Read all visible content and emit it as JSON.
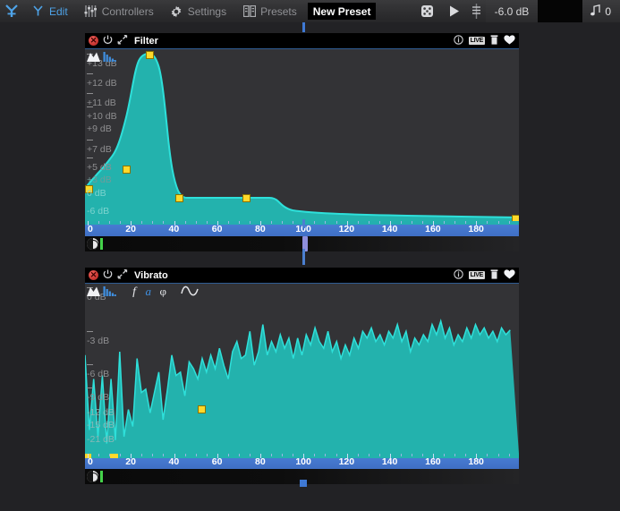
{
  "topbar": {
    "logo_icon": "synth-logo-icon",
    "menu": [
      {
        "label": "Edit",
        "icon": "edit-fork-icon",
        "active": true
      },
      {
        "label": "Controllers",
        "icon": "sliders-icon",
        "active": false
      },
      {
        "label": "Settings",
        "icon": "gear-icon",
        "active": false
      },
      {
        "label": "Presets",
        "icon": "library-books-icon",
        "active": false
      }
    ],
    "preset_name": "New Preset",
    "dice_icon": "dice-randomize-icon",
    "play_icon": "play-icon",
    "fader_icon": "mini-fader-icon",
    "volume_db": "-6.0 dB",
    "voice_icon": "music-note-icon",
    "voice_count": "0"
  },
  "panels": [
    {
      "id": "filter",
      "title": "Filter",
      "close_icon": "close-icon",
      "power_icon": "power-icon",
      "expand_icon": "expand-arrows-icon",
      "info_icon": "info-icon",
      "live_label": "LIVE",
      "delete_icon": "trash-icon",
      "favorite_icon": "heart-icon",
      "toolbar_icons": [
        "envelope-curve-icon",
        "bar-chart-icon"
      ],
      "y_labels": [
        {
          "text": "+13 dB",
          "y": 10
        },
        {
          "text": "+12 dB",
          "y": 32
        },
        {
          "text": "+11 dB",
          "y": 54
        },
        {
          "text": "+10 dB",
          "y": 69
        },
        {
          "text": "+9 dB",
          "y": 83
        },
        {
          "text": "+7 dB",
          "y": 106
        },
        {
          "text": "+5 dB",
          "y": 126
        },
        {
          "text": "+3 dB",
          "y": 140
        },
        {
          "text": "0 dB",
          "y": 155
        },
        {
          "text": "-6 dB",
          "y": 175
        }
      ],
      "x_ticks": [
        "0",
        "20",
        "40",
        "60",
        "80",
        "100",
        "120",
        "140",
        "160",
        "180"
      ],
      "transport": {
        "knob_icon": "phase-knob-icon",
        "start_marker": "green-start-marker"
      }
    },
    {
      "id": "vibrato",
      "title": "Vibrato",
      "close_icon": "close-icon",
      "power_icon": "power-icon",
      "expand_icon": "expand-arrows-icon",
      "info_icon": "info-icon",
      "live_label": "LIVE",
      "delete_icon": "trash-icon",
      "favorite_icon": "heart-icon",
      "toolbar_icons": [
        "envelope-curve-icon",
        "bar-chart-icon",
        "frequency-f-icon",
        "amplitude-a-icon",
        "phase-phi-icon",
        "sine-wave-icon"
      ],
      "y_labels": [
        {
          "text": "0 dB",
          "y": 9
        },
        {
          "text": "-3 dB",
          "y": 58
        },
        {
          "text": "-6 dB",
          "y": 95
        },
        {
          "text": "-9 dB",
          "y": 121
        },
        {
          "text": "-12 dB",
          "y": 138
        },
        {
          "text": "-15 dB",
          "y": 152
        },
        {
          "text": "-21 dB",
          "y": 168
        }
      ],
      "x_ticks": [
        "0",
        "20",
        "40",
        "60",
        "80",
        "100",
        "120",
        "140",
        "160",
        "180"
      ],
      "transport": {
        "knob_icon": "phase-knob-icon",
        "start_marker": "green-start-marker"
      }
    }
  ],
  "colors": {
    "accent_blue": "#4ea3e8",
    "ruler_blue": "#4076cc",
    "curve_teal": "#2bc9c4",
    "curve_fill": "#23b2ad",
    "node_yellow": "#ffd92b",
    "close_red": "#d4352f",
    "playhead": "#8f8fdc",
    "panel_bg": "#333336"
  },
  "chart_data": [
    {
      "type": "line",
      "title": "Filter",
      "xlabel": "",
      "ylabel": "dB",
      "xlim": [
        0,
        200
      ],
      "ylim": [
        -8,
        14
      ],
      "grid": false,
      "x": [
        0,
        2,
        5,
        10,
        14,
        18,
        22,
        25,
        27,
        29,
        31,
        33,
        35,
        37,
        40,
        45,
        60,
        72,
        74,
        78,
        90,
        110,
        140,
        170,
        195
      ],
      "y": [
        0.2,
        1.5,
        2.6,
        3.2,
        4.4,
        5.6,
        8.5,
        11.4,
        13.2,
        13.4,
        12.9,
        8.6,
        2.0,
        -3.6,
        -5.2,
        -5.3,
        -5.3,
        -5.3,
        -5.3,
        -6.4,
        -6.9,
        -7.2,
        -7.4,
        -7.5,
        -7.6
      ],
      "control_points": [
        {
          "x": 0,
          "y": 0.1
        },
        {
          "x": 14,
          "y": 4.6
        },
        {
          "x": 27,
          "y": 13.4
        },
        {
          "x": 40,
          "y": -5.3
        },
        {
          "x": 73,
          "y": -5.3
        },
        {
          "x": 196,
          "y": -7.7
        }
      ]
    },
    {
      "type": "area",
      "title": "Vibrato",
      "xlabel": "",
      "ylabel": "dB",
      "xlim": [
        0,
        200
      ],
      "ylim": [
        -24,
        1
      ],
      "grid": false,
      "control_points": [
        {
          "x": 58,
          "y": -11.5
        }
      ],
      "x": [
        0,
        2,
        4,
        6,
        8,
        10,
        12,
        14,
        16,
        18,
        20,
        22,
        24,
        26,
        28,
        30,
        32,
        34,
        36,
        38,
        40,
        42,
        44,
        46,
        48,
        50,
        52,
        54,
        56,
        58,
        60,
        62,
        64,
        66,
        68,
        70,
        72,
        74,
        76,
        78,
        80,
        82,
        84,
        86,
        88,
        90,
        92,
        94,
        96,
        98,
        100,
        102,
        104,
        106,
        108,
        110,
        112,
        114,
        116,
        118,
        120,
        122,
        124,
        126,
        128,
        130,
        132,
        134,
        136,
        138,
        140,
        142,
        144,
        146,
        148,
        150,
        152,
        154,
        156,
        158,
        160,
        162,
        164,
        166,
        168,
        170,
        172,
        174,
        176,
        178,
        180,
        182,
        184,
        186,
        188,
        190,
        192,
        194,
        196
      ],
      "y": [
        -9.5,
        -20.5,
        -13.0,
        -21.5,
        -12.5,
        -22.5,
        -13.0,
        -22.0,
        -9.0,
        -21.5,
        -17.5,
        -20.0,
        -10.0,
        -15.0,
        -14.5,
        -18.0,
        -15.0,
        -12.0,
        -19.0,
        -14.5,
        -9.5,
        -12.5,
        -12.0,
        -15.5,
        -10.5,
        -11.5,
        -13.0,
        -10.0,
        -12.0,
        -9.5,
        -11.5,
        -8.5,
        -11.0,
        -13.0,
        -9.0,
        -7.5,
        -10.0,
        -9.5,
        -6.0,
        -11.0,
        -9.0,
        -5.0,
        -9.5,
        -7.5,
        -9.0,
        -6.5,
        -8.5,
        -7.0,
        -10.0,
        -7.0,
        -9.5,
        -6.5,
        -8.0,
        -5.5,
        -7.5,
        -8.5,
        -6.0,
        -9.0,
        -7.5,
        -10.0,
        -8.0,
        -9.5,
        -7.0,
        -8.5,
        -6.0,
        -7.0,
        -5.5,
        -7.5,
        -6.5,
        -8.0,
        -6.0,
        -7.0,
        -5.0,
        -7.5,
        -6.0,
        -9.0,
        -7.0,
        -8.0,
        -6.5,
        -7.5,
        -5.0,
        -6.5,
        -4.5,
        -7.0,
        -5.5,
        -8.0,
        -6.5,
        -7.5,
        -5.5,
        -7.0,
        -5.0,
        -6.5,
        -5.5,
        -7.0,
        -6.0,
        -7.5,
        -5.5,
        -6.5,
        -5.8
      ]
    }
  ]
}
